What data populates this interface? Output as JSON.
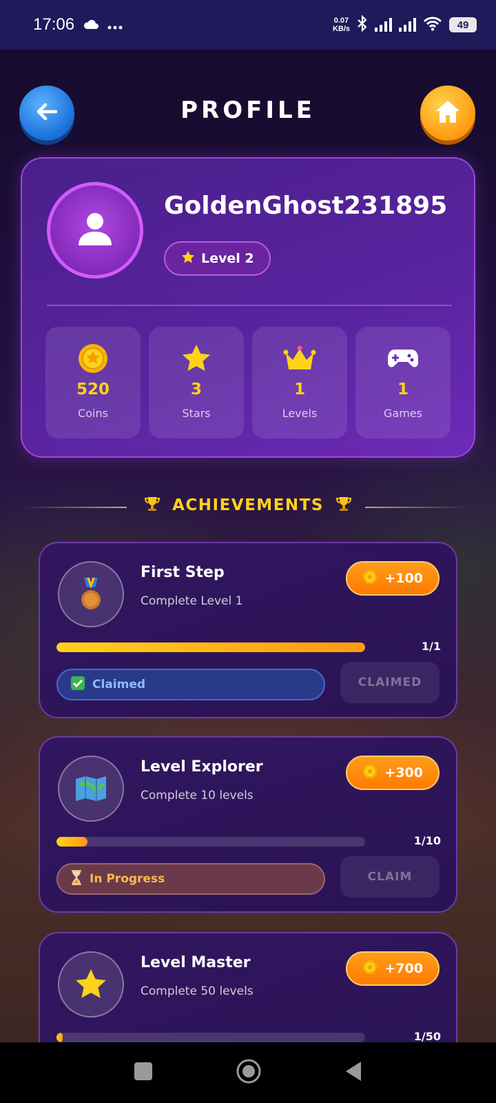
{
  "status_bar": {
    "time": "17:06",
    "icons": [
      "cloud-icon",
      "more-icon"
    ],
    "net_speed_value": "0.07",
    "net_speed_unit": "KB/s",
    "battery": "49"
  },
  "header": {
    "title": "PROFILE",
    "back_icon": "arrow-left-icon",
    "home_icon": "home-icon"
  },
  "profile": {
    "username": "GoldenGhost231895",
    "level_label": "Level 2",
    "stats": [
      {
        "icon": "coin-icon",
        "value": "520",
        "label": "Coins"
      },
      {
        "icon": "star-icon",
        "value": "3",
        "label": "Stars"
      },
      {
        "icon": "crown-icon",
        "value": "1",
        "label": "Levels"
      },
      {
        "icon": "gamepad-icon",
        "value": "1",
        "label": "Games"
      }
    ]
  },
  "achievements": {
    "title": "ACHIEVEMENTS",
    "items": [
      {
        "icon": "medal-icon",
        "name": "First Step",
        "description": "Complete Level 1",
        "reward": "+100",
        "progress_text": "1/1",
        "progress_fraction": 1.0,
        "status": "Claimed",
        "action": "CLAIMED"
      },
      {
        "icon": "map-icon",
        "name": "Level Explorer",
        "description": "Complete 10 levels",
        "reward": "+300",
        "progress_text": "1/10",
        "progress_fraction": 0.1,
        "status": "In Progress",
        "action": "CLAIM"
      },
      {
        "icon": "star-icon",
        "name": "Level Master",
        "description": "Complete 50 levels",
        "reward": "+700",
        "progress_text": "1/50",
        "progress_fraction": 0.02,
        "status": "",
        "action": ""
      }
    ]
  },
  "colors": {
    "accent_gold": "#ffd21a",
    "card_purple": "#5a24a0",
    "reward_orange": "#ff8a0a"
  }
}
